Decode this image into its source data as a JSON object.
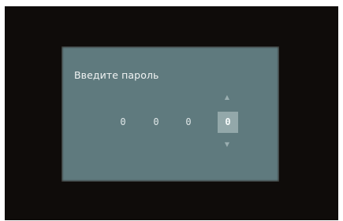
{
  "dialog": {
    "prompt": "Введите пароль"
  },
  "password": {
    "digits": [
      "0",
      "0",
      "0",
      "0"
    ],
    "active_index": 3
  },
  "icons": {
    "up": "arrow-up-icon",
    "down": "arrow-down-icon"
  },
  "colors": {
    "screen_bg": "#0f0c0a",
    "dialog_bg": "#5f7a7e",
    "active_digit_bg": "#93a8aa",
    "text": "#f1f4f4"
  }
}
